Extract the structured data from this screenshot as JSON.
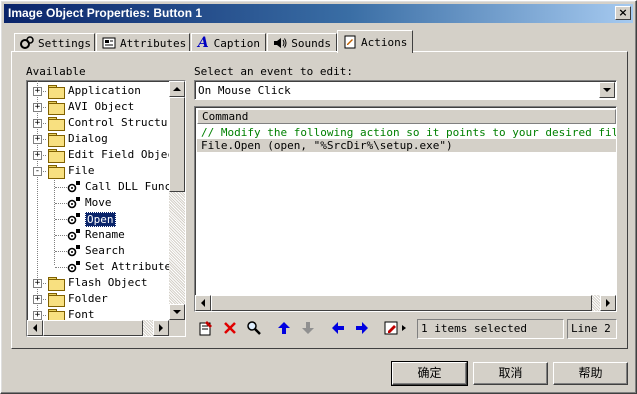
{
  "window": {
    "title": "Image Object Properties: Button 1",
    "close_glyph": "×"
  },
  "tabs": [
    {
      "label": "Settings",
      "icon": "settings-icon"
    },
    {
      "label": "Attributes",
      "icon": "attributes-icon"
    },
    {
      "label": "Caption",
      "icon": "caption-icon"
    },
    {
      "label": "Sounds",
      "icon": "sounds-icon"
    },
    {
      "label": "Actions",
      "icon": "actions-icon",
      "active": true
    }
  ],
  "available": {
    "label": "Available",
    "items": [
      {
        "label": "Application",
        "type": "folder",
        "expander": "+"
      },
      {
        "label": "AVI Object",
        "type": "folder",
        "expander": "+"
      },
      {
        "label": "Control Structure",
        "type": "folder",
        "expander": "+"
      },
      {
        "label": "Dialog",
        "type": "folder",
        "expander": "+"
      },
      {
        "label": "Edit Field Object",
        "type": "folder",
        "expander": "+"
      },
      {
        "label": "File",
        "type": "folder",
        "expander": "-"
      },
      {
        "label": "Call DLL Function",
        "type": "action"
      },
      {
        "label": "Move",
        "type": "action"
      },
      {
        "label": "Open",
        "type": "action",
        "selected": true
      },
      {
        "label": "Rename",
        "type": "action"
      },
      {
        "label": "Search",
        "type": "action"
      },
      {
        "label": "Set Attributes",
        "type": "action"
      },
      {
        "label": "Flash Object",
        "type": "folder",
        "expander": "+"
      },
      {
        "label": "Folder",
        "type": "folder",
        "expander": "+"
      },
      {
        "label": "Font",
        "type": "folder",
        "expander": "+"
      }
    ]
  },
  "event": {
    "label": "Select an event to edit:",
    "selected": "On Mouse Click"
  },
  "editor": {
    "column_header": "Command",
    "lines": [
      {
        "text": "// Modify the following action so it points to your desired file",
        "kind": "comment"
      },
      {
        "text": "File.Open (open, \"%SrcDir%\\setup.exe\")",
        "kind": "code"
      }
    ]
  },
  "toolbar": {
    "icons": [
      "add-action-icon",
      "delete-icon",
      "search-icon",
      "move-up-icon",
      "move-down-icon",
      "move-left-icon",
      "move-right-icon",
      "edit-icon"
    ]
  },
  "status": {
    "selection": "1 items selected",
    "line": "Line 2"
  },
  "buttons": {
    "ok": "确定",
    "cancel": "取消",
    "help": "帮助"
  },
  "colors": {
    "title_gradient_start": "#0a246a",
    "selection": "#0a246a",
    "comment": "#008000",
    "arrow_blue": "#0000e0"
  }
}
